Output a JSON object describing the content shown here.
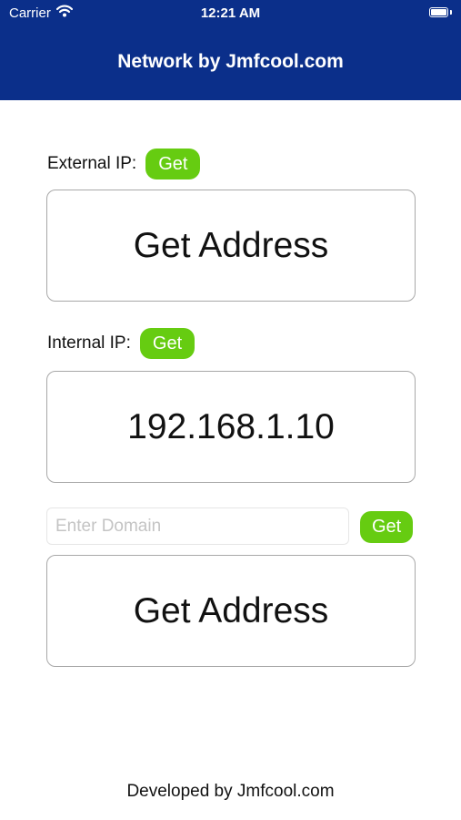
{
  "status_bar": {
    "carrier": "Carrier",
    "time": "12:21 AM"
  },
  "nav": {
    "title": "Network by Jmfcool.com"
  },
  "external": {
    "label": "External IP:",
    "button": "Get",
    "result": "Get Address"
  },
  "internal": {
    "label": "Internal IP:",
    "button": "Get",
    "result": "192.168.1.10"
  },
  "domain": {
    "placeholder": "Enter Domain",
    "value": "",
    "button": "Get",
    "result": "Get Address"
  },
  "footer": {
    "text": "Developed by Jmfcool.com"
  },
  "colors": {
    "nav": "#0b2f8a",
    "button": "#66cc11",
    "border": "#a8a8a8"
  },
  "icons": {
    "wifi": "wifi-icon",
    "battery": "battery-icon"
  }
}
